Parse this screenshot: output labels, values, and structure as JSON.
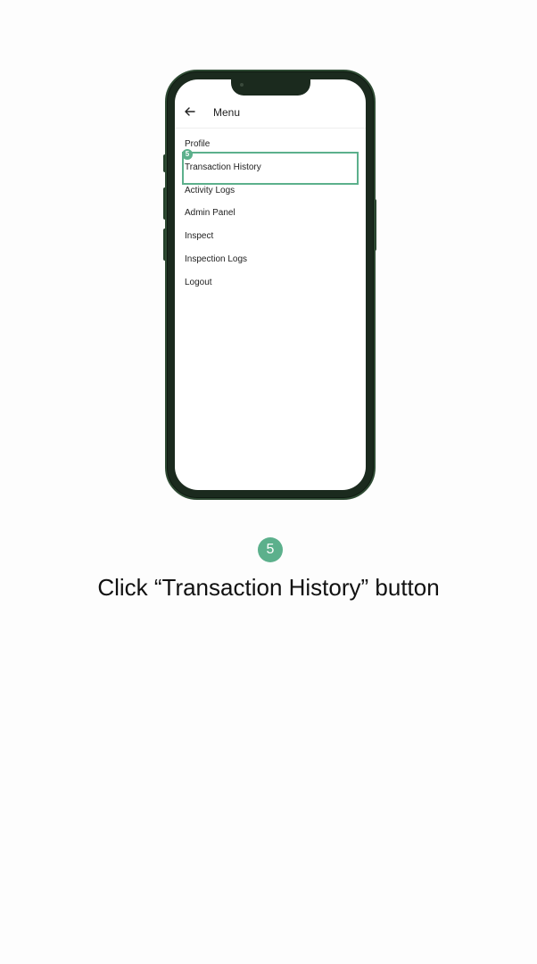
{
  "header": {
    "back_icon": "arrow-left-icon",
    "title": "Menu"
  },
  "menu": {
    "items": [
      {
        "label": "Profile"
      },
      {
        "label": "Transaction History"
      },
      {
        "label": "Activity Logs"
      },
      {
        "label": "Admin Panel"
      },
      {
        "label": "Inspect"
      },
      {
        "label": "Inspection Logs"
      },
      {
        "label": "Logout"
      }
    ],
    "highlighted_index": 1
  },
  "step": {
    "number": "5",
    "instruction": "Click “Transaction History” button"
  },
  "colors": {
    "accent": "#5cb08c",
    "phone_frame": "#1b2a1e",
    "background": "#fdfdfd"
  }
}
